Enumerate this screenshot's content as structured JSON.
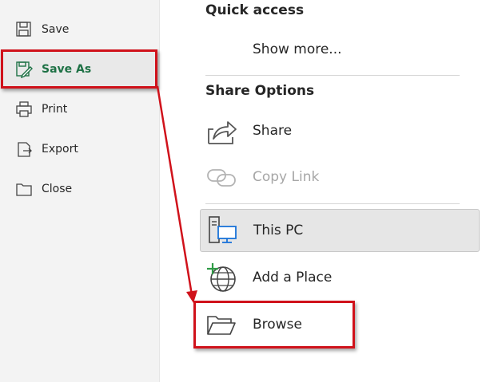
{
  "sidebar": {
    "items": [
      {
        "label": "Save",
        "icon": "save-icon"
      },
      {
        "label": "Save As",
        "icon": "save-as-icon"
      },
      {
        "label": "Print",
        "icon": "print-icon"
      },
      {
        "label": "Export",
        "icon": "export-icon"
      },
      {
        "label": "Close",
        "icon": "close-folder-icon"
      }
    ],
    "active_color": "#1e7145"
  },
  "main": {
    "quick_access_title": "Quick access",
    "show_more": "Show more...",
    "share_options_title": "Share Options",
    "share_label": "Share",
    "copy_link_label": "Copy Link",
    "locations": [
      {
        "label": "This PC",
        "icon": "this-pc-icon"
      },
      {
        "label": "Add a Place",
        "icon": "add-place-globe-icon"
      },
      {
        "label": "Browse",
        "icon": "folder-open-icon"
      }
    ]
  },
  "annotation_color": "#d0121b"
}
